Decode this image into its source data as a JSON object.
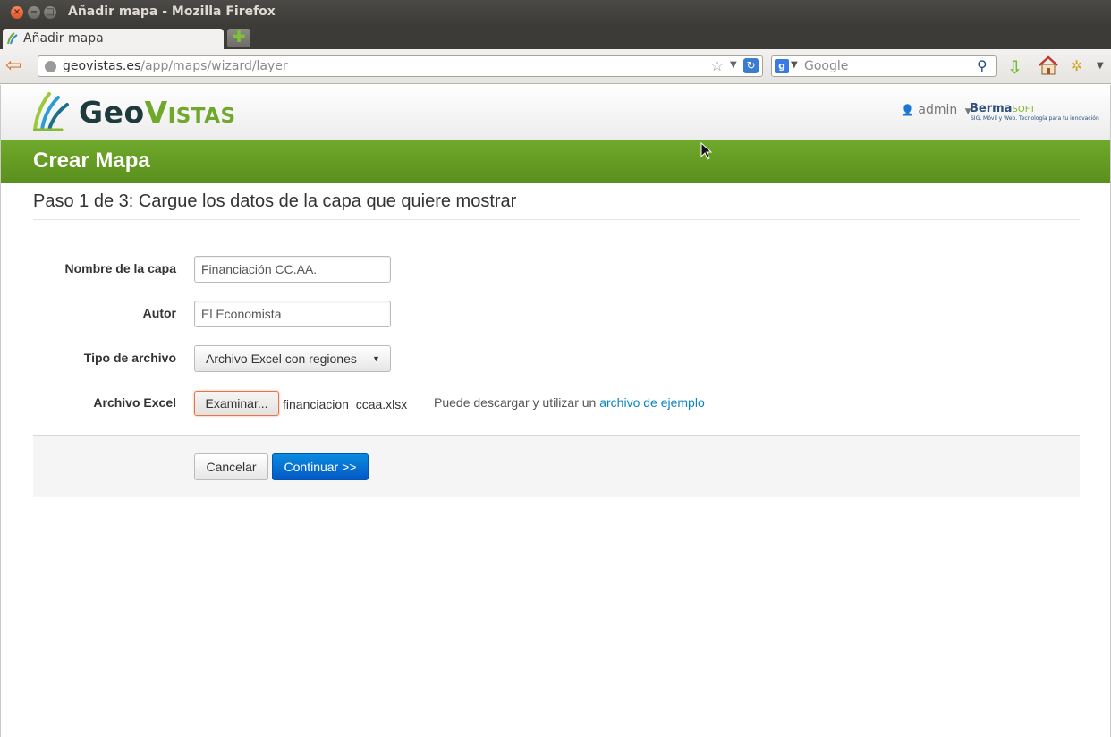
{
  "window": {
    "title": "Añadir mapa - Mozilla Firefox",
    "close_glyph": "×",
    "minimize_glyph": "−",
    "maximize_glyph": "□"
  },
  "tabs": [
    {
      "label": "Añadir mapa",
      "favicon": "geovistas-favicon"
    }
  ],
  "new_tab_glyph": "✚",
  "navbar": {
    "back_glyph": "⇦",
    "url_host": "geovistas.es",
    "url_path": "/app/maps/wizard/layer",
    "bookmark_glyph": "☆",
    "dropdown_glyph": "▼",
    "reload_glyph": "↻",
    "search_engine_glyph": "g",
    "search_placeholder": "Google",
    "search_glyph": "⚲",
    "download_glyph": "⇩",
    "addon_glyph": "✲"
  },
  "site": {
    "logo_geo": "Geo",
    "logo_vistas": "Vistas",
    "user_icon_glyph": "👤",
    "user_name": "admin",
    "user_caret": "▼",
    "partner_name": "Berma",
    "partner_suffix": "SOFT",
    "partner_tagline": "SIG, Móvil y Web. Tecnología para tu innovación"
  },
  "page": {
    "heading": "Crear Mapa",
    "step_title": "Paso 1 de 3: Cargue los datos de la capa que quiere mostrar"
  },
  "form": {
    "layer_name_label": "Nombre de la capa",
    "layer_name_value": "Financiación CC.AA.",
    "author_label": "Autor",
    "author_value": "El Economista",
    "file_type_label": "Tipo de archivo",
    "file_type_selected": "Archivo Excel con regiones",
    "file_type_caret": "▼",
    "excel_label": "Archivo Excel",
    "browse_label": "Examinar...",
    "file_name": "financiacion_ccaa.xlsx",
    "hint_text": "Puede descargar y utilizar un ",
    "hint_link": "archivo de ejemplo"
  },
  "actions": {
    "cancel_label": "Cancelar",
    "continue_label": "Continuar >>"
  },
  "colors": {
    "accent_green": "#6fa92b",
    "primary_blue": "#0458c5",
    "link_blue": "#0a84c1"
  }
}
